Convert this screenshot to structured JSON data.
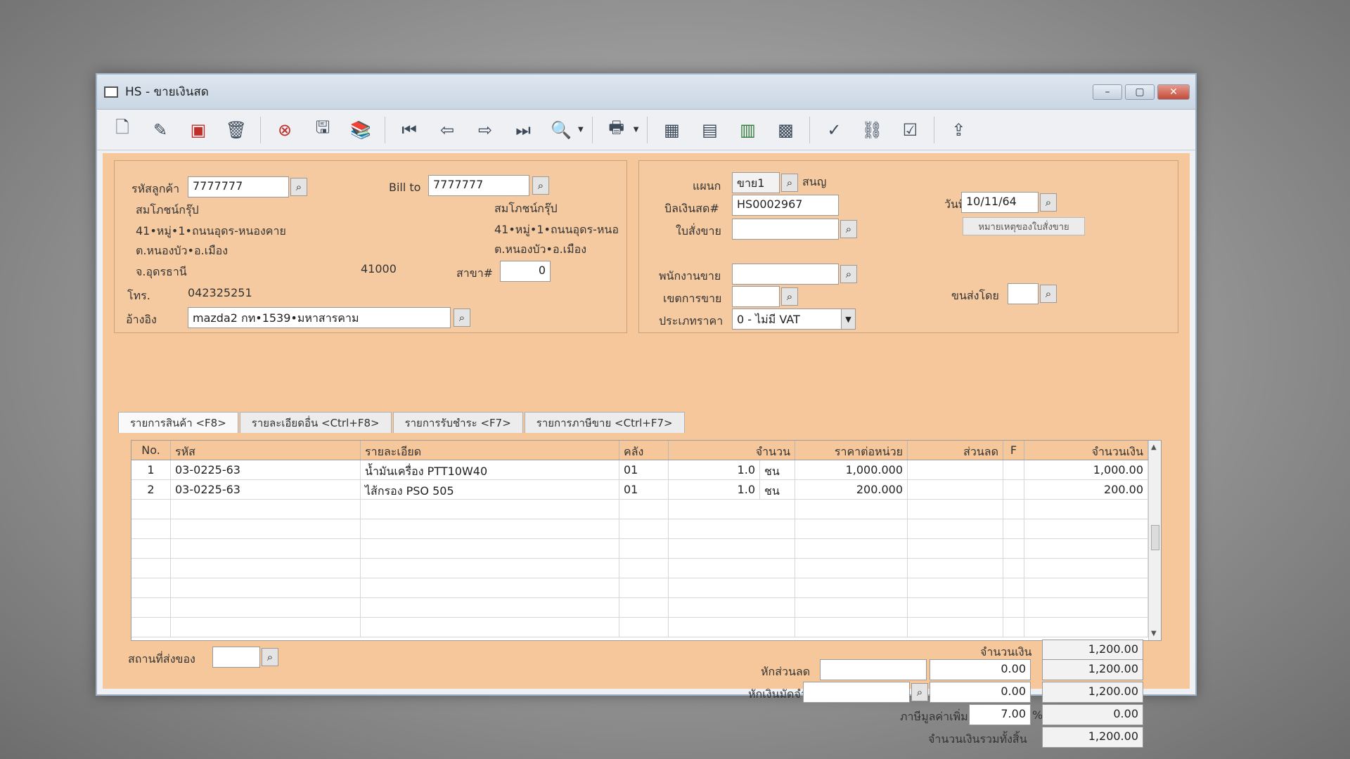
{
  "window": {
    "title": "HS - ขายเงินสด",
    "controls": {
      "minimize": "–",
      "maximize": "▢",
      "close": "✕"
    }
  },
  "toolbar": {
    "icons": [
      "new-document-icon",
      "edit-icon",
      "void-icon",
      "trash-icon",
      "cancel-icon",
      "save-icon",
      "books-icon",
      "first-record-icon",
      "previous-record-icon",
      "next-record-icon",
      "last-record-icon",
      "search-icon",
      "printer-icon",
      "calculator-icon",
      "screen-icon",
      "report-icon",
      "calendar-icon",
      "approve-icon",
      "link-icon",
      "confirm-ok-icon",
      "export-icon"
    ]
  },
  "customer": {
    "code_label": "รหัสลูกค้า",
    "code_value": "7777777",
    "name": "สมโภชน์กรุ๊ป",
    "address1": "41•หมู่•1•ถนนอุดร-หนองคาย",
    "address2": "ต.หนองบัว•อ.เมือง",
    "address3": "จ.อุดรธานี",
    "postcode": "41000",
    "phone_label": "โทร.",
    "phone_value": "042325251",
    "reference_label": "อ้างอิง",
    "reference_value": "mazda2 กท•1539•มหาสารคาม",
    "branch_label": "สาขา#",
    "branch_value": "0"
  },
  "bill_to": {
    "label": "Bill to",
    "value": "7777777",
    "name": "สมโภชน์กรุ๊ป",
    "address1": "41•หมู่•1•ถนนอุดร-หนอ",
    "address2": "ต.หนองบัว•อ.เมือง"
  },
  "document": {
    "department_label": "แผนก",
    "department_value": "ขาย1",
    "department_name": "สนญ",
    "cash_bill_label": "บิลเงินสด#",
    "cash_bill_value": "HS0002967",
    "sales_order_label": "ใบสั่งขาย",
    "sales_order_value": "",
    "date_label": "วันที่",
    "date_value": "10/11/64",
    "note_button": "หมายเหตุของใบสั่งขาย",
    "salesperson_label": "พนักงานขาย",
    "salesperson_value": "",
    "sales_area_label": "เขตการขาย",
    "sales_area_value": "",
    "ship_by_label": "ขนส่งโดย",
    "ship_by_value": "",
    "price_type_label": "ประเภทราคา",
    "price_type_value": "0 - ไม่มี VAT"
  },
  "tabs": [
    {
      "label": "รายการสินค้า <F8>",
      "active": true
    },
    {
      "label": "รายละเอียดอื่น <Ctrl+F8>",
      "active": false
    },
    {
      "label": "รายการรับชำระ <F7>",
      "active": false
    },
    {
      "label": "รายการภาษีขาย <Ctrl+F7>",
      "active": false
    }
  ],
  "table": {
    "headers": [
      "No.",
      "รหัส",
      "รายละเอียด",
      "คลัง",
      "จำนวน",
      "ราคาต่อหน่วย",
      "ส่วนลด",
      "F",
      "จำนวนเงิน"
    ],
    "rows": [
      {
        "no": "1",
        "code": "03-0225-63",
        "desc": "น้ำมันเครื่อง PTT10W40",
        "wh": "01",
        "qty": "1.0",
        "unit": "ชน",
        "price": "1,000.000",
        "disc": "",
        "f": "",
        "amount": "1,000.00"
      },
      {
        "no": "2",
        "code": "03-0225-63",
        "desc": "ไส้กรอง PSO 505",
        "wh": "01",
        "qty": "1.0",
        "unit": "ชน",
        "price": "200.000",
        "disc": "",
        "f": "",
        "amount": "200.00"
      }
    ]
  },
  "footer": {
    "ship_place_label": "สถานที่ส่งของ",
    "ship_place_value": "",
    "amount_label": "จำนวนเงิน",
    "amount_value": "1,200.00",
    "discount_label": "หักส่วนลด",
    "discount_text": "",
    "discount_value": "0.00",
    "discount_total": "1,200.00",
    "deposit_label": "หักเงินมัดจำ",
    "deposit_text": "",
    "deposit_value": "0.00",
    "deposit_total": "1,200.00",
    "vat_label": "ภาษีมูลค่าเพิ่ม",
    "vat_rate": "7.00",
    "vat_percent": "%",
    "vat_value": "0.00",
    "grand_total_label": "จำนวนเงินรวมทั้งสิ้น",
    "grand_total_value": "1,200.00"
  }
}
